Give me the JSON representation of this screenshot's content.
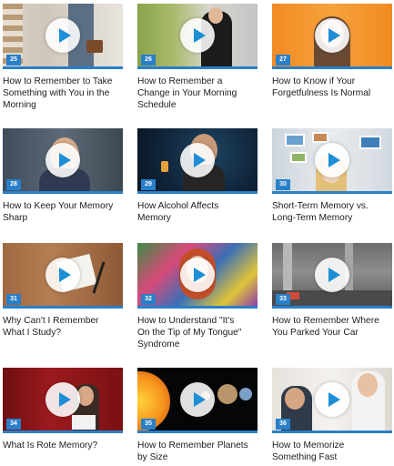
{
  "videos": [
    {
      "num": "25",
      "title_lines": [
        "How to Remember to Take",
        "Something with You in the",
        "Morning"
      ]
    },
    {
      "num": "26",
      "title_lines": [
        "How to Remember a",
        "Change in Your Morning",
        "Schedule"
      ]
    },
    {
      "num": "27",
      "title_lines": [
        "How to Know if Your",
        "Forgetfulness Is Normal"
      ]
    },
    {
      "num": "28",
      "title_lines": [
        "How to Keep Your Memory",
        "Sharp"
      ]
    },
    {
      "num": "29",
      "title_lines": [
        "How Alcohol Affects",
        "Memory"
      ]
    },
    {
      "num": "30",
      "title_lines": [
        "Short-Term Memory vs.",
        "Long-Term Memory"
      ]
    },
    {
      "num": "31",
      "title_lines": [
        "Why Can't I Remember",
        "What I Study?"
      ]
    },
    {
      "num": "32",
      "title_lines": [
        "How to Understand \"It's",
        "On the Tip of My Tongue\"",
        "Syndrome"
      ]
    },
    {
      "num": "33",
      "title_lines": [
        "How to Remember Where",
        "You Parked Your Car"
      ]
    },
    {
      "num": "34",
      "title_lines": [
        "What Is Rote Memory?"
      ]
    },
    {
      "num": "35",
      "title_lines": [
        "How to Remember Planets",
        "by Size"
      ]
    },
    {
      "num": "36",
      "title_lines": [
        "How to Memorize",
        "Something Fast"
      ]
    }
  ],
  "icons": {
    "play": "play-icon"
  },
  "colors": {
    "accent": "#2a7fc9",
    "play_triangle": "#1e8fd6",
    "title_text": "#1c1c1c"
  }
}
